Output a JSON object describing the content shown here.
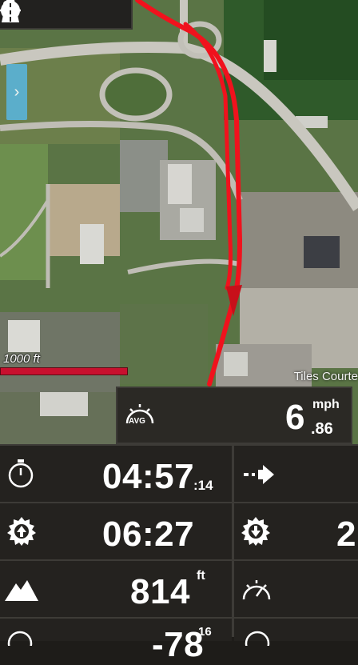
{
  "toolbar": {
    "icons": [
      "crosshair-icon",
      "stop-icon",
      "route-nodes-icon",
      "road-icon"
    ]
  },
  "drawer": {
    "arrow": "›"
  },
  "scale": {
    "label": "1000 ft"
  },
  "attribution": "Tiles Courte",
  "avg_speed": {
    "badge": "AVG",
    "value": "6",
    "decimal": ".86",
    "unit": "mph"
  },
  "metrics": [
    {
      "icon": "stopwatch-icon",
      "value": "04:57",
      "sub": ":14"
    },
    {
      "icon": "sunrise-icon",
      "value": "06:27"
    },
    {
      "icon": "elevation-icon",
      "value": "814",
      "unit": "ft"
    },
    {
      "icon": "compass-icon",
      "value": "-78",
      "sub": "16"
    }
  ],
  "side_metrics": [
    {
      "icon": "turn-arrow-icon",
      "value": ""
    },
    {
      "icon": "sunset-icon",
      "value": "2"
    },
    {
      "icon": "speedometer-icon",
      "value": ""
    },
    {
      "icon": "compass-icon",
      "value": ""
    }
  ],
  "colors": {
    "route": "#f0121d",
    "panel": "#24221f",
    "accent": "#5ab2d6"
  }
}
